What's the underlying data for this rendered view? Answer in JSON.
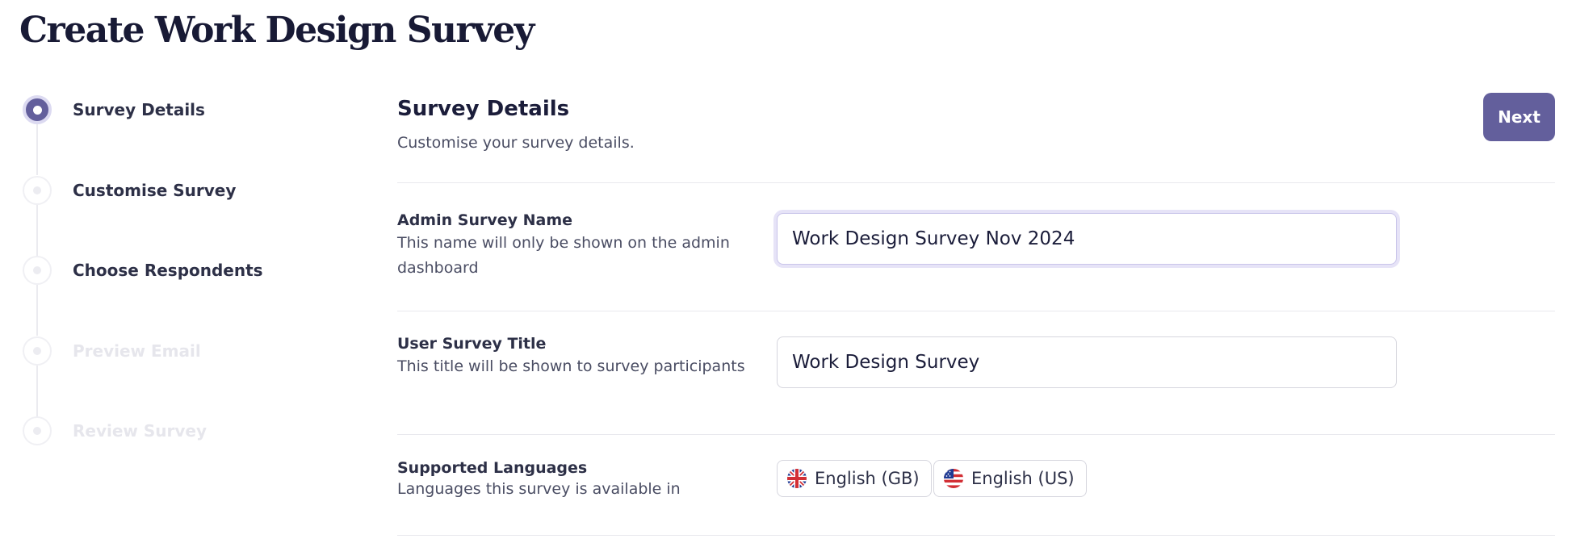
{
  "page": {
    "title": "Create Work Design Survey"
  },
  "stepper": {
    "steps": [
      {
        "label": "Survey Details",
        "state": "active"
      },
      {
        "label": "Customise Survey",
        "state": "enabled"
      },
      {
        "label": "Choose Respondents",
        "state": "enabled"
      },
      {
        "label": "Preview Email",
        "state": "disabled"
      },
      {
        "label": "Review Survey",
        "state": "disabled"
      }
    ]
  },
  "main": {
    "section_title": "Survey Details",
    "section_subtitle": "Customise your survey details.",
    "next_label": "Next",
    "admin_name": {
      "label": "Admin Survey Name",
      "description": "This name will only be shown on the admin dashboard",
      "value": "Work Design Survey Nov 2024"
    },
    "user_title": {
      "label": "User Survey Title",
      "description": "This title will be shown to survey participants",
      "value": "Work Design Survey"
    },
    "languages": {
      "label": "Supported Languages",
      "description": "Languages this survey is available in",
      "items": [
        {
          "label": "English (GB)",
          "icon": "uk-flag-icon"
        },
        {
          "label": "English (US)",
          "icon": "us-flag-icon"
        }
      ]
    }
  },
  "colors": {
    "accent": "#635f9c",
    "accent_ring": "#dcdaf1",
    "divider": "#e9e9ee",
    "disabled_text": "#e6e6ec"
  }
}
